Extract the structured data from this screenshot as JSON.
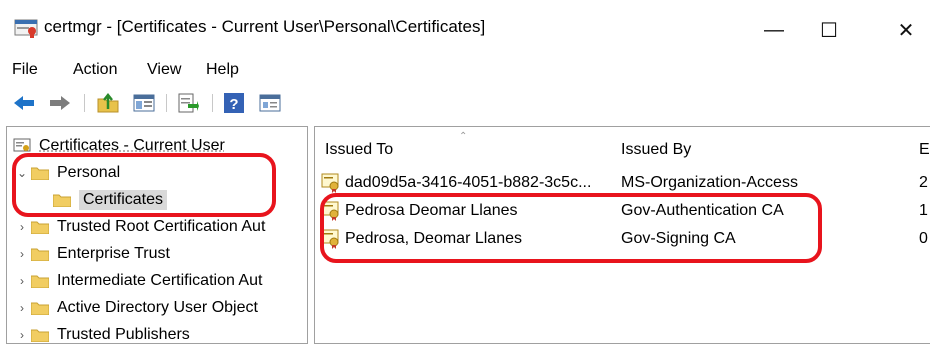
{
  "window": {
    "title": "certmgr - [Certificates - Current User\\Personal\\Certificates]",
    "minimize": "—",
    "maximize": "☐",
    "close": "✕"
  },
  "menu": {
    "items": [
      "File",
      "Action",
      "View",
      "Help"
    ]
  },
  "toolbar": {
    "buttons": [
      "back-arrow-icon",
      "forward-arrow-icon",
      "up-folder-icon",
      "show-hide-tree-icon",
      "export-list-icon",
      "help-icon",
      "properties-icon"
    ]
  },
  "tree": {
    "root": "Certificates - Current User",
    "items": [
      {
        "label": "Personal",
        "expanded": true
      },
      {
        "label": "Certificates",
        "selected": true
      },
      {
        "label": "Trusted Root Certification Aut"
      },
      {
        "label": "Enterprise Trust"
      },
      {
        "label": "Intermediate Certification Aut"
      },
      {
        "label": "Active Directory User Object"
      },
      {
        "label": "Trusted Publishers"
      }
    ]
  },
  "list": {
    "columns": {
      "issued_to": "Issued To",
      "issued_by": "Issued By",
      "third": "E"
    },
    "rows": [
      {
        "issued_to": "dad09d5a-3416-4051-b882-3c5c...",
        "issued_by": "MS-Organization-Access",
        "third": "2"
      },
      {
        "issued_to": "Pedrosa Deomar Llanes",
        "issued_by": "Gov-Authentication CA",
        "third": "1"
      },
      {
        "issued_to": "Pedrosa, Deomar Llanes",
        "issued_by": "Gov-Signing CA",
        "third": "0"
      }
    ]
  },
  "colors": {
    "annotation": "#e8141d",
    "selection": "#d9d9d9",
    "arrow_blue": "#1e73c8"
  }
}
